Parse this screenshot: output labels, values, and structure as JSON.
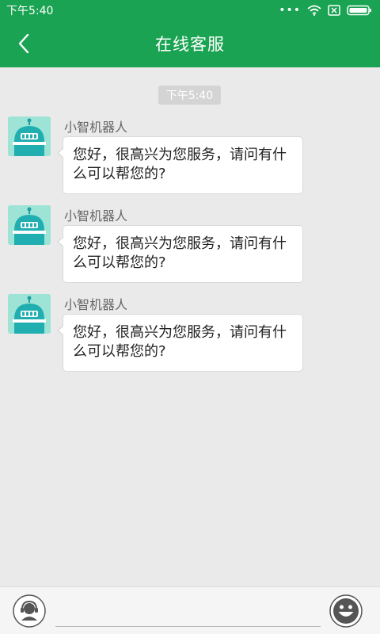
{
  "status_bar": {
    "time": "下午5:40",
    "icons": [
      "more-dots-icon",
      "wifi-icon",
      "sim-icon",
      "battery-icon"
    ]
  },
  "header": {
    "title": "在线客服",
    "back_icon": "back-chevron-icon"
  },
  "chat": {
    "time_label": "下午5:40",
    "messages": [
      {
        "sender": "小智机器人",
        "text": "您好，很高兴为您服务，请问有什么可以帮您的?"
      },
      {
        "sender": "小智机器人",
        "text": "您好，很高兴为您服务，请问有什么可以帮您的?"
      },
      {
        "sender": "小智机器人",
        "text": "您好，很高兴为您服务，请问有什么可以帮您的?"
      }
    ]
  },
  "input_bar": {
    "value": "",
    "placeholder": "",
    "left_icon": "customer-service-icon",
    "right_icon": "emoji-icon"
  },
  "colors": {
    "primary": "#1aa352",
    "chat_background": "#eaeaea",
    "bubble": "#ffffff",
    "avatar_background": "#9de4d6",
    "robot_teal": "#20aeb0"
  }
}
